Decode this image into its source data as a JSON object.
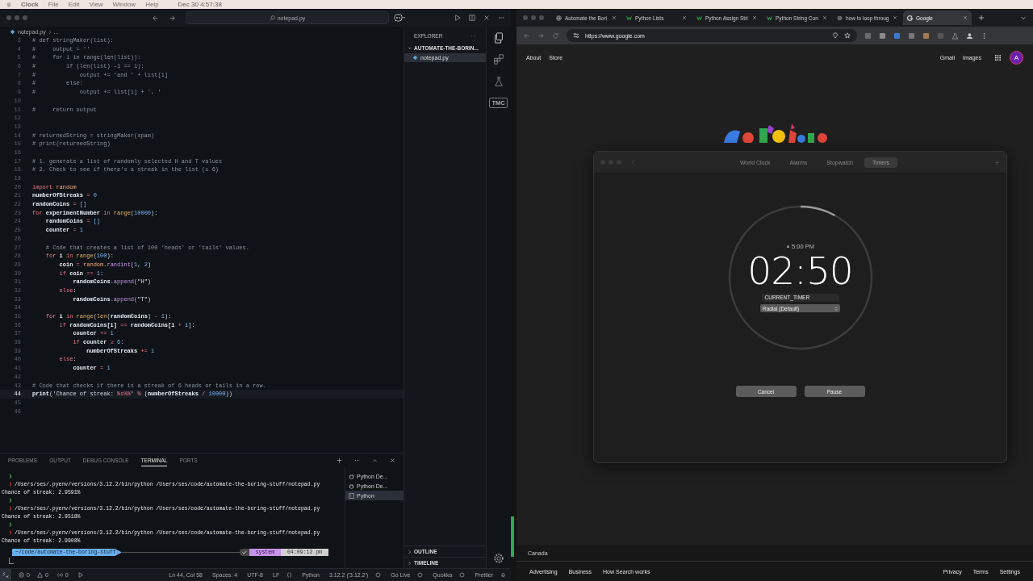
{
  "menu_bar": {
    "items": [
      "Clock",
      "File",
      "Edit",
      "View",
      "Window",
      "Help"
    ],
    "clock": "Dec 30  4:57:38"
  },
  "editor_window": {
    "search": "notepad.py",
    "breadcrumb": {
      "file": "notepad.py",
      "rest": "..."
    },
    "lines": [
      {
        "number": "3",
        "active": false,
        "tokens": [
          {
            "text": "# def stringMaker(list):",
            "kind": "comment"
          }
        ]
      },
      {
        "number": "4",
        "active": false,
        "tokens": [
          {
            "text": "#     output = ''",
            "kind": "comment"
          }
        ]
      },
      {
        "number": "5",
        "active": false,
        "tokens": [
          {
            "text": "#     for i in range(len(list)):",
            "kind": "comment"
          }
        ]
      },
      {
        "number": "6",
        "active": false,
        "tokens": [
          {
            "text": "#         if (len(list) -1 == i):",
            "kind": "comment"
          }
        ]
      },
      {
        "number": "7",
        "active": false,
        "tokens": [
          {
            "text": "#             output += 'and ' + list[i]",
            "kind": "comment"
          }
        ]
      },
      {
        "number": "8",
        "active": false,
        "tokens": [
          {
            "text": "#         else:",
            "kind": "comment"
          }
        ]
      },
      {
        "number": "9",
        "active": false,
        "tokens": [
          {
            "text": "#             output += list[i] + ', '",
            "kind": "comment"
          }
        ]
      },
      {
        "number": "10",
        "active": false
      },
      {
        "number": "11",
        "active": false,
        "tokens": [
          {
            "text": "#     return output",
            "kind": "comment"
          }
        ]
      },
      {
        "number": "12",
        "active": false
      },
      {
        "number": "13",
        "active": false
      },
      {
        "number": "14",
        "active": false,
        "tokens": [
          {
            "text": "# returnedString = stringMaker(spam)",
            "kind": "comment"
          }
        ]
      },
      {
        "number": "15",
        "active": false,
        "tokens": [
          {
            "text": "# print(returnedString)",
            "kind": "comment"
          }
        ]
      },
      {
        "number": "16",
        "active": false
      },
      {
        "number": "17",
        "active": false,
        "tokens": [
          {
            "text": "# 1. generate a list of randomly selected H and T values",
            "kind": "comment"
          }
        ]
      },
      {
        "number": "18",
        "active": false,
        "tokens": [
          {
            "text": "# 2. Check to see if there's a streak in the list (≥ 6)",
            "kind": "comment"
          }
        ]
      },
      {
        "number": "19",
        "active": false
      },
      {
        "number": "20",
        "active": false,
        "tokens": [
          {
            "text": "import",
            "kind": "keyword"
          },
          {
            "text": " random",
            "kind": "module"
          }
        ]
      },
      {
        "number": "21",
        "active": false,
        "tokens": [
          {
            "text": "numberOfStreaks",
            "kind": "ident"
          },
          {
            "text": " = ",
            "kind": "operator"
          },
          {
            "text": "0",
            "kind": "number"
          }
        ]
      },
      {
        "number": "22",
        "active": false,
        "tokens": [
          {
            "text": "randomCoins",
            "kind": "ident"
          },
          {
            "text": " = ",
            "kind": "operator"
          },
          {
            "text": "[]",
            "kind": "number"
          }
        ]
      },
      {
        "number": "23",
        "active": false,
        "tokens": [
          {
            "text": "for",
            "kind": "keyword"
          },
          {
            "text": " experimentNumber ",
            "kind": "ident"
          },
          {
            "text": "in",
            "kind": "keyword"
          },
          {
            "text": " range",
            "kind": "builtin"
          },
          {
            "text": "(",
            "kind": "plain"
          },
          {
            "text": "10000",
            "kind": "number"
          },
          {
            "text": "):",
            "kind": "plain"
          }
        ]
      },
      {
        "number": "24",
        "active": false,
        "tokens": [
          {
            "text": "    randomCoins",
            "kind": "ident"
          },
          {
            "text": " = ",
            "kind": "operator"
          },
          {
            "text": "[]",
            "kind": "number"
          }
        ]
      },
      {
        "number": "25",
        "active": false,
        "tokens": [
          {
            "text": "    counter",
            "kind": "ident"
          },
          {
            "text": " = ",
            "kind": "operator"
          },
          {
            "text": "1",
            "kind": "number"
          }
        ]
      },
      {
        "number": "26",
        "active": false
      },
      {
        "number": "27",
        "active": false,
        "tokens": [
          {
            "text": "    # Code that creates a list of 100 'heads' or 'tails' values.",
            "kind": "comment"
          }
        ]
      },
      {
        "number": "28",
        "active": false,
        "tokens": [
          {
            "text": "    for",
            "kind": "keyword"
          },
          {
            "text": " i ",
            "kind": "ident"
          },
          {
            "text": "in",
            "kind": "keyword"
          },
          {
            "text": " range",
            "kind": "builtin"
          },
          {
            "text": "(",
            "kind": "plain"
          },
          {
            "text": "100",
            "kind": "number"
          },
          {
            "text": "):",
            "kind": "plain"
          }
        ]
      },
      {
        "number": "29",
        "active": false,
        "tokens": [
          {
            "text": "        coin",
            "kind": "ident"
          },
          {
            "text": " = ",
            "kind": "operator"
          },
          {
            "text": "random",
            "kind": "module"
          },
          {
            "text": ".",
            "kind": "plain"
          },
          {
            "text": "randint",
            "kind": "method"
          },
          {
            "text": "(",
            "kind": "plain"
          },
          {
            "text": "1",
            "kind": "number"
          },
          {
            "text": ", ",
            "kind": "plain"
          },
          {
            "text": "2",
            "kind": "number"
          },
          {
            "text": ")",
            "kind": "plain"
          }
        ]
      },
      {
        "number": "30",
        "active": false,
        "tokens": [
          {
            "text": "        if",
            "kind": "keyword"
          },
          {
            "text": " coin ",
            "kind": "ident"
          },
          {
            "text": "==",
            "kind": "operator"
          },
          {
            "text": " 1",
            "kind": "number"
          },
          {
            "text": ":",
            "kind": "plain"
          }
        ]
      },
      {
        "number": "31",
        "active": false,
        "tokens": [
          {
            "text": "            randomCoins",
            "kind": "ident"
          },
          {
            "text": ".",
            "kind": "plain"
          },
          {
            "text": "append",
            "kind": "method"
          },
          {
            "text": "(",
            "kind": "plain"
          },
          {
            "text": "\"H\"",
            "kind": "string"
          },
          {
            "text": ")",
            "kind": "plain"
          }
        ]
      },
      {
        "number": "32",
        "active": false,
        "tokens": [
          {
            "text": "        else",
            "kind": "keyword"
          },
          {
            "text": ":",
            "kind": "plain"
          }
        ]
      },
      {
        "number": "33",
        "active": false,
        "tokens": [
          {
            "text": "            randomCoins",
            "kind": "ident"
          },
          {
            "text": ".",
            "kind": "plain"
          },
          {
            "text": "append",
            "kind": "method"
          },
          {
            "text": "(",
            "kind": "plain"
          },
          {
            "text": "\"T\"",
            "kind": "string"
          },
          {
            "text": ")",
            "kind": "plain"
          }
        ]
      },
      {
        "number": "34",
        "active": false
      },
      {
        "number": "35",
        "active": false,
        "tokens": [
          {
            "text": "    for",
            "kind": "keyword"
          },
          {
            "text": " i ",
            "kind": "ident"
          },
          {
            "text": "in",
            "kind": "keyword"
          },
          {
            "text": " range",
            "kind": "builtin"
          },
          {
            "text": "(",
            "kind": "plain"
          },
          {
            "text": "len",
            "kind": "builtin"
          },
          {
            "text": "(",
            "kind": "plain"
          },
          {
            "text": "randomCoins",
            "kind": "ident"
          },
          {
            "text": ") ",
            "kind": "plain"
          },
          {
            "text": "-",
            "kind": "operator"
          },
          {
            "text": " 1",
            "kind": "number"
          },
          {
            "text": "):",
            "kind": "plain"
          }
        ]
      },
      {
        "number": "36",
        "active": false,
        "tokens": [
          {
            "text": "        if",
            "kind": "keyword"
          },
          {
            "text": " randomCoins[i] ",
            "kind": "ident"
          },
          {
            "text": "==",
            "kind": "operator"
          },
          {
            "text": " randomCoins[i ",
            "kind": "ident"
          },
          {
            "text": "+",
            "kind": "operator"
          },
          {
            "text": " 1",
            "kind": "number"
          },
          {
            "text": "]:",
            "kind": "plain"
          }
        ]
      },
      {
        "number": "37",
        "active": false,
        "tokens": [
          {
            "text": "            counter ",
            "kind": "ident"
          },
          {
            "text": "+=",
            "kind": "operator"
          },
          {
            "text": " 1",
            "kind": "number"
          }
        ]
      },
      {
        "number": "38",
        "active": false,
        "tokens": [
          {
            "text": "            if",
            "kind": "keyword"
          },
          {
            "text": " counter ",
            "kind": "ident"
          },
          {
            "text": "≥",
            "kind": "operator"
          },
          {
            "text": " 6",
            "kind": "number"
          },
          {
            "text": ":",
            "kind": "plain"
          }
        ]
      },
      {
        "number": "39",
        "active": false,
        "tokens": [
          {
            "text": "                numberOfStreaks ",
            "kind": "ident"
          },
          {
            "text": "+=",
            "kind": "operator"
          },
          {
            "text": " 1",
            "kind": "number"
          }
        ]
      },
      {
        "number": "40",
        "active": false,
        "tokens": [
          {
            "text": "        else",
            "kind": "keyword"
          },
          {
            "text": ":",
            "kind": "plain"
          }
        ]
      },
      {
        "number": "41",
        "active": false,
        "tokens": [
          {
            "text": "            counter ",
            "kind": "ident"
          },
          {
            "text": "=",
            "kind": "operator"
          },
          {
            "text": " 1",
            "kind": "number"
          }
        ]
      },
      {
        "number": "42",
        "active": false
      },
      {
        "number": "43",
        "active": false,
        "tokens": [
          {
            "text": "# Code that checks if there is a streak of 6 heads or tails in a row.",
            "kind": "comment"
          }
        ]
      },
      {
        "number": "44",
        "active": true,
        "tokens": [
          {
            "text": "print",
            "kind": "ident"
          },
          {
            "text": "(",
            "kind": "plain"
          },
          {
            "text": "'Chance of streak: ",
            "kind": "string"
          },
          {
            "text": "%s%%",
            "kind": "operator"
          },
          {
            "text": "'",
            "kind": "string"
          },
          {
            "text": " %",
            "kind": "operator"
          },
          {
            "text": " (",
            "kind": "plain"
          },
          {
            "text": "numberOfStreaks ",
            "kind": "ident"
          },
          {
            "text": "/",
            "kind": "operator"
          },
          {
            "text": " 10000",
            "kind": "number"
          },
          {
            "text": "))",
            "kind": "plain"
          }
        ]
      },
      {
        "number": "45",
        "active": false
      },
      {
        "number": "46",
        "active": false
      }
    ],
    "explorer": {
      "title": "EXPLORER",
      "more": "···",
      "folder": "AUTOMATE-THE-BORIN...",
      "files": [
        {
          "name": "notepad.py",
          "selected": true
        }
      ]
    },
    "activity_badge": "TMC",
    "sections": [
      "OUTLINE",
      "TIMELINE"
    ],
    "panel": {
      "tabs": [
        {
          "label": "PROBLEMS",
          "selected": false
        },
        {
          "label": "OUTPUT",
          "selected": false
        },
        {
          "label": "DEBUG CONSOLE",
          "selected": false
        },
        {
          "label": "TERMINAL",
          "selected": true
        },
        {
          "label": "PORTS",
          "selected": false
        }
      ],
      "terminal_lines": [
        {
          "kind": "prompt",
          "symbol": "❯"
        },
        {
          "kind": "command",
          "symbol": "❯",
          "text": "/Users/ses/.pyenv/versions/3.12.2/bin/python /Users/ses/code/automate-the-boring-stuff/notepad.py"
        },
        {
          "kind": "output",
          "text": "Chance of streak: 2.9591%"
        },
        {
          "kind": "prompt",
          "symbol": "❯"
        },
        {
          "kind": "command",
          "symbol": "❯",
          "text": "/Users/ses/.pyenv/versions/3.12.2/bin/python /Users/ses/code/automate-the-boring-stuff/notepad.py"
        },
        {
          "kind": "output",
          "text": "Chance of streak: 2.9518%"
        },
        {
          "kind": "prompt",
          "symbol": "❯"
        },
        {
          "kind": "command",
          "symbol": "❯",
          "text": "/Users/ses/.pyenv/versions/3.12.2/bin/python /Users/ses/code/automate-the-boring-stuff/notepad.py"
        },
        {
          "kind": "output",
          "text": "Chance of streak: 2.9908%"
        }
      ],
      "prompt": {
        "path": "~/code/automate-the-boring-stuff",
        "env": "system",
        "time": "04:09:12 pm"
      },
      "sessions": [
        {
          "label": "Python De...",
          "kind": "debug",
          "selected": false
        },
        {
          "label": "Python De...",
          "kind": "debug",
          "selected": false
        },
        {
          "label": "Python",
          "kind": "shell",
          "selected": true
        }
      ]
    },
    "status_bar": {
      "errors": "0",
      "warnings": "0",
      "ports": "0",
      "right": [
        "Ln 44, Col 58",
        "Spaces: 4",
        "UTF-8",
        "LF"
      ],
      "language": "Python",
      "interpreter": "3.12.2 ('3.12.2')",
      "extensions": [
        "Go Live",
        "Quokka",
        "Prettier"
      ]
    }
  },
  "browser": {
    "tabs": [
      {
        "title": "Automate the Bori",
        "kind": "book",
        "selected": false
      },
      {
        "title": "Python Lists",
        "kind": "tutorial",
        "selected": false
      },
      {
        "title": "Python Assign Stri",
        "kind": "tutorial",
        "selected": false
      },
      {
        "title": "Python String Con",
        "kind": "tutorial",
        "selected": false
      },
      {
        "title": "how to loop throug",
        "kind": "forum",
        "selected": false
      },
      {
        "title": "Google",
        "kind": "search",
        "selected": true
      }
    ],
    "url": "https://www.google.com",
    "header_left": [
      "About",
      "Store"
    ],
    "header_right": [
      "Gmail",
      "Images"
    ],
    "avatar": "A",
    "region": "Canada",
    "footer_left": [
      "Advertising",
      "Business",
      "How Search works"
    ],
    "footer_right": [
      "Privacy",
      "Terms",
      "Settings"
    ]
  },
  "clock_window": {
    "tabs": [
      {
        "label": "World Clock",
        "selected": false
      },
      {
        "label": "Alarms",
        "selected": false
      },
      {
        "label": "Stopwatch",
        "selected": false
      },
      {
        "label": "Timers",
        "selected": true
      }
    ],
    "alarm_time": "5:00 PM",
    "remaining": "02:50",
    "level": 0.08,
    "timer_name": "CURRENT_TIMER",
    "style": "Radial (Default)",
    "buttons": [
      "Cancel",
      "Pause"
    ]
  }
}
